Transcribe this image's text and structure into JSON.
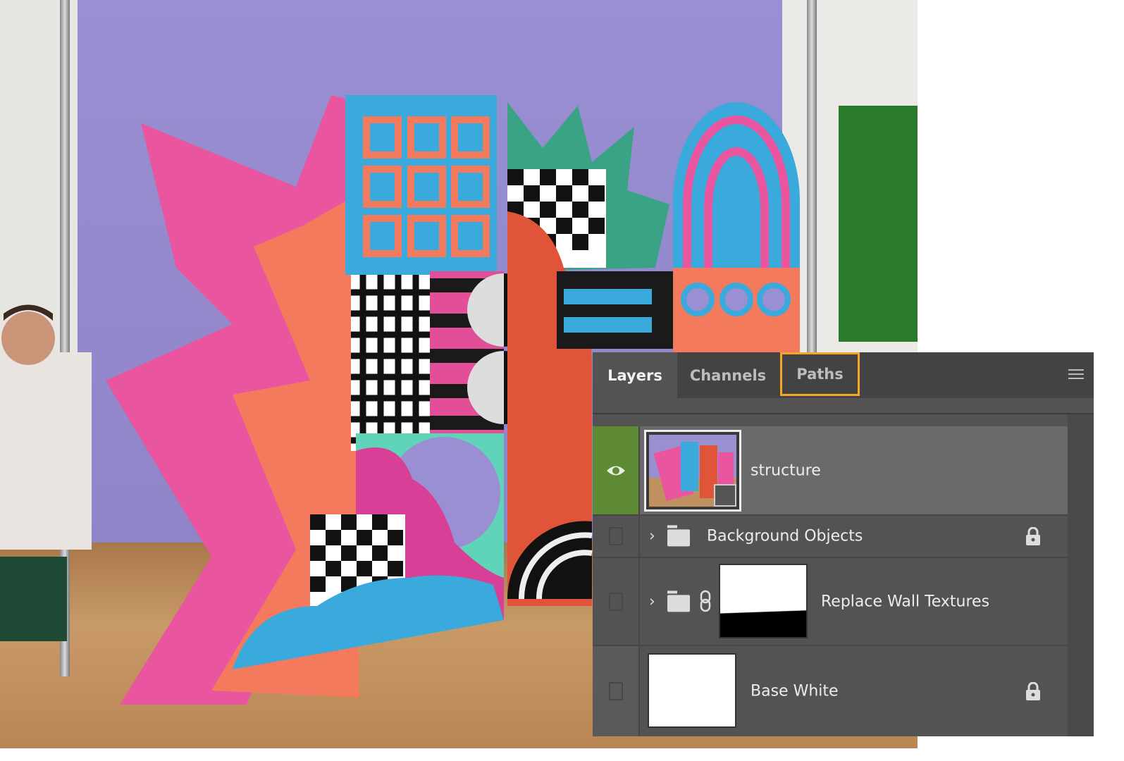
{
  "panel": {
    "tabs": [
      {
        "label": "Layers",
        "active": true
      },
      {
        "label": "Channels",
        "active": false
      },
      {
        "label": "Paths",
        "active": false,
        "highlighted": true
      }
    ],
    "highlight_color": "#f5a623",
    "menu_icon": "panel-menu-icon"
  },
  "layers": [
    {
      "name": "structure",
      "visible": true,
      "selected": true,
      "type": "smart-object"
    },
    {
      "name": "Background Objects",
      "visible": false,
      "type": "group",
      "locked": true
    },
    {
      "name": "Replace Wall Textures",
      "visible": false,
      "type": "group",
      "linked_mask": true
    },
    {
      "name": "Base White",
      "visible": false,
      "type": "layer",
      "locked": true
    }
  ],
  "colors": {
    "visibility_green": "#5e8a34",
    "panel_bg": "#535353"
  }
}
